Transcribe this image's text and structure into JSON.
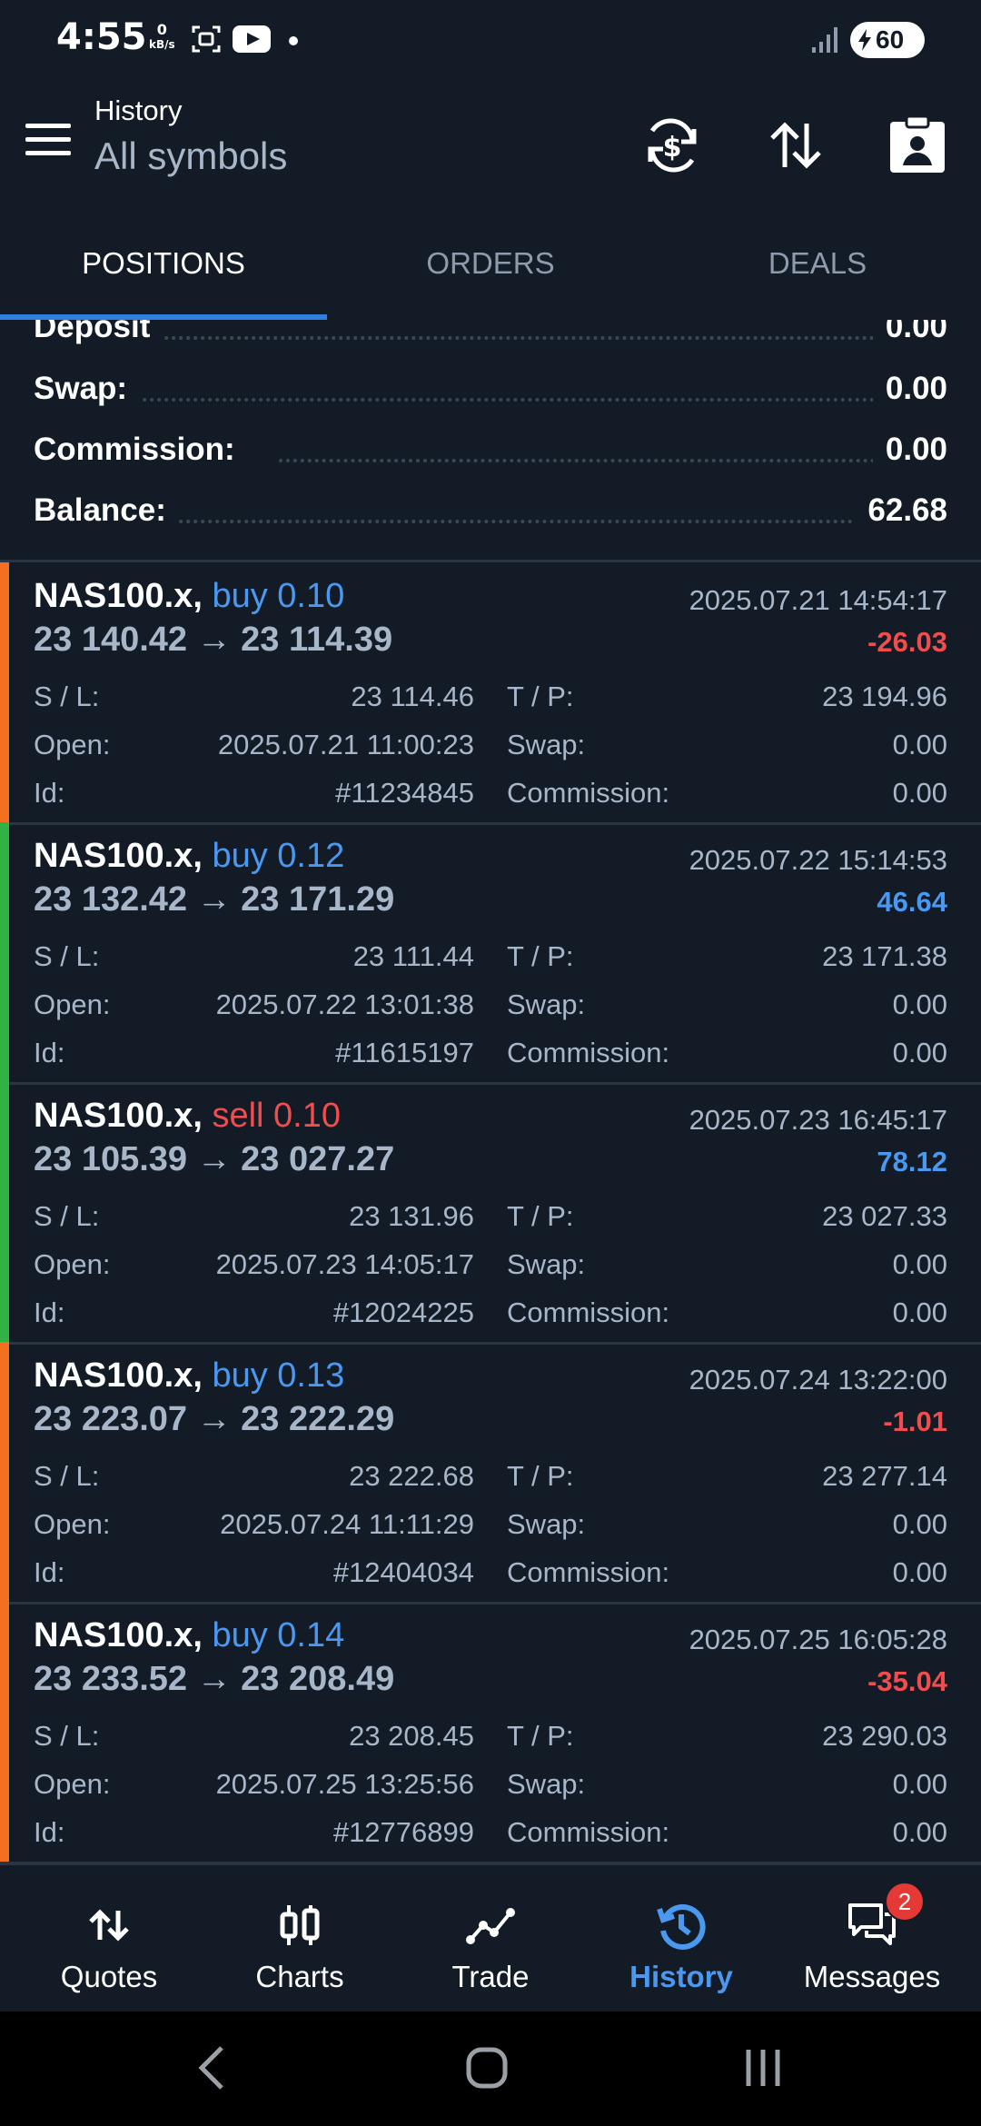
{
  "status_bar": {
    "time": "4:55",
    "net_speed_value": "0",
    "net_speed_unit": "kB/s",
    "battery": "60"
  },
  "header": {
    "title": "History",
    "subtitle": "All symbols"
  },
  "tabs": [
    {
      "label": "POSITIONS",
      "active": true
    },
    {
      "label": "ORDERS",
      "active": false
    },
    {
      "label": "DEALS",
      "active": false
    }
  ],
  "summary": [
    {
      "label": "Deposit",
      "value": "0.00"
    },
    {
      "label": "Swap:",
      "value": "0.00"
    },
    {
      "label": "Commission:",
      "value": "0.00"
    },
    {
      "label": "Balance:",
      "value": "62.68"
    }
  ],
  "labels": {
    "sl": "S / L:",
    "tp": "T / P:",
    "open": "Open:",
    "swap": "Swap:",
    "id": "Id:",
    "commission": "Commission:"
  },
  "positions": [
    {
      "symbol": "NAS100.x,",
      "side": "buy 0.10",
      "close_time": "2025.07.21 14:54:17",
      "prices": "23 140.42 → 23 114.39",
      "profit": "-26.03",
      "sl": "23 114.46",
      "tp": "23 194.96",
      "open": "2025.07.21 11:00:23",
      "swap": "0.00",
      "id": "#11234845",
      "commission": "0.00"
    },
    {
      "symbol": "NAS100.x,",
      "side": "buy 0.12",
      "close_time": "2025.07.22 15:14:53",
      "prices": "23 132.42 → 23 171.29",
      "profit": "46.64",
      "sl": "23 111.44",
      "tp": "23 171.38",
      "open": "2025.07.22 13:01:38",
      "swap": "0.00",
      "id": "#11615197",
      "commission": "0.00"
    },
    {
      "symbol": "NAS100.x,",
      "side": "sell 0.10",
      "close_time": "2025.07.23 16:45:17",
      "prices": "23 105.39 → 23 027.27",
      "profit": "78.12",
      "sl": "23 131.96",
      "tp": "23 027.33",
      "open": "2025.07.23 14:05:17",
      "swap": "0.00",
      "id": "#12024225",
      "commission": "0.00"
    },
    {
      "symbol": "NAS100.x,",
      "side": "buy 0.13",
      "close_time": "2025.07.24 13:22:00",
      "prices": "23 223.07 → 23 222.29",
      "profit": "-1.01",
      "sl": "23 222.68",
      "tp": "23 277.14",
      "open": "2025.07.24 11:11:29",
      "swap": "0.00",
      "id": "#12404034",
      "commission": "0.00"
    },
    {
      "symbol": "NAS100.x,",
      "side": "buy 0.14",
      "close_time": "2025.07.25 16:05:28",
      "prices": "23 233.52 → 23 208.49",
      "profit": "-35.04",
      "sl": "23 208.45",
      "tp": "23 290.03",
      "open": "2025.07.25 13:25:56",
      "swap": "0.00",
      "id": "#12776899",
      "commission": "0.00"
    }
  ],
  "bottom_nav": [
    {
      "label": "Quotes",
      "icon": "quotes-icon"
    },
    {
      "label": "Charts",
      "icon": "charts-icon"
    },
    {
      "label": "Trade",
      "icon": "trade-icon"
    },
    {
      "label": "History",
      "icon": "history-icon",
      "active": true
    },
    {
      "label": "Messages",
      "icon": "messages-icon",
      "badge": "2"
    }
  ],
  "colors": {
    "background": "#121b26",
    "accent": "#4a98f0",
    "loss": "#f04e4e",
    "loss_bar": "#f37021",
    "profit_bar": "#2fb344",
    "tab_underline": "#2f7fe0"
  }
}
